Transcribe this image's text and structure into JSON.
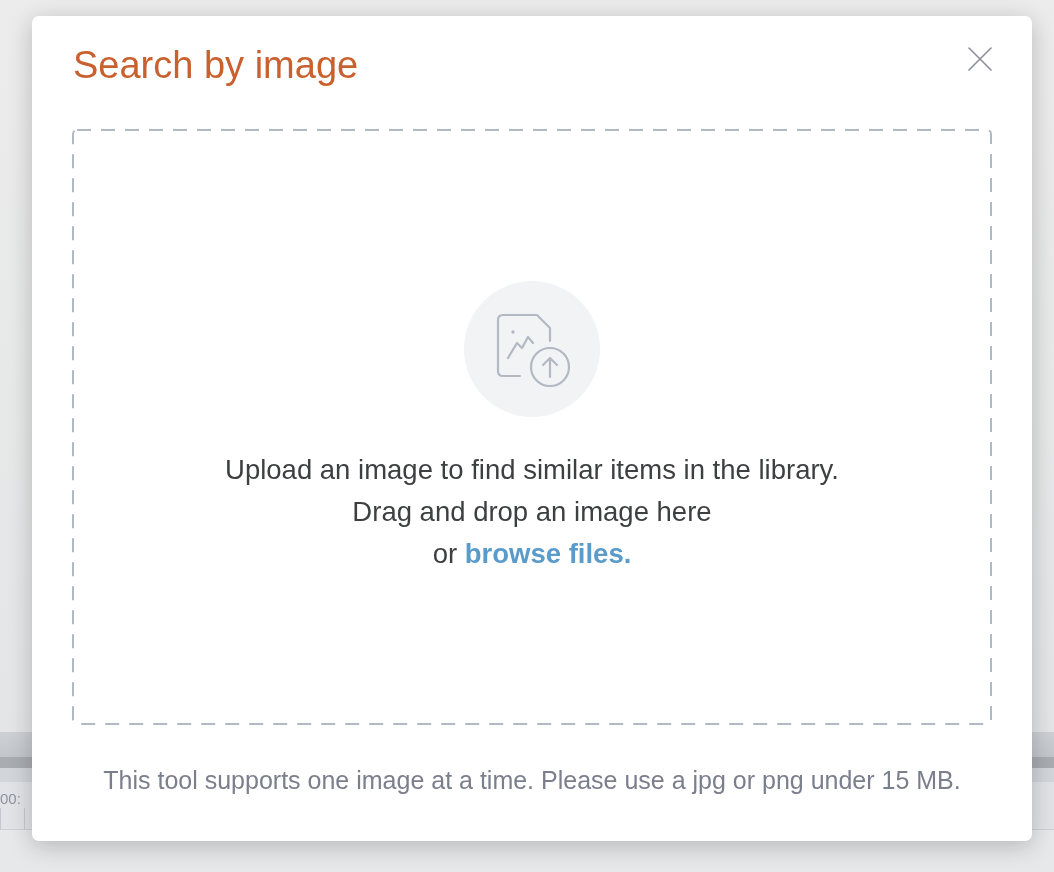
{
  "background": {
    "timeline_timecode": "00:"
  },
  "dialog": {
    "title": "Search by image",
    "dropzone": {
      "instructions": [
        "Upload an image to find similar items in the library.",
        "Drag and drop an image here"
      ],
      "link_prefix": "or",
      "link": "browse files."
    },
    "footer_note": "This tool supports one image at a time. Please use a jpg or png under 15 MB."
  }
}
